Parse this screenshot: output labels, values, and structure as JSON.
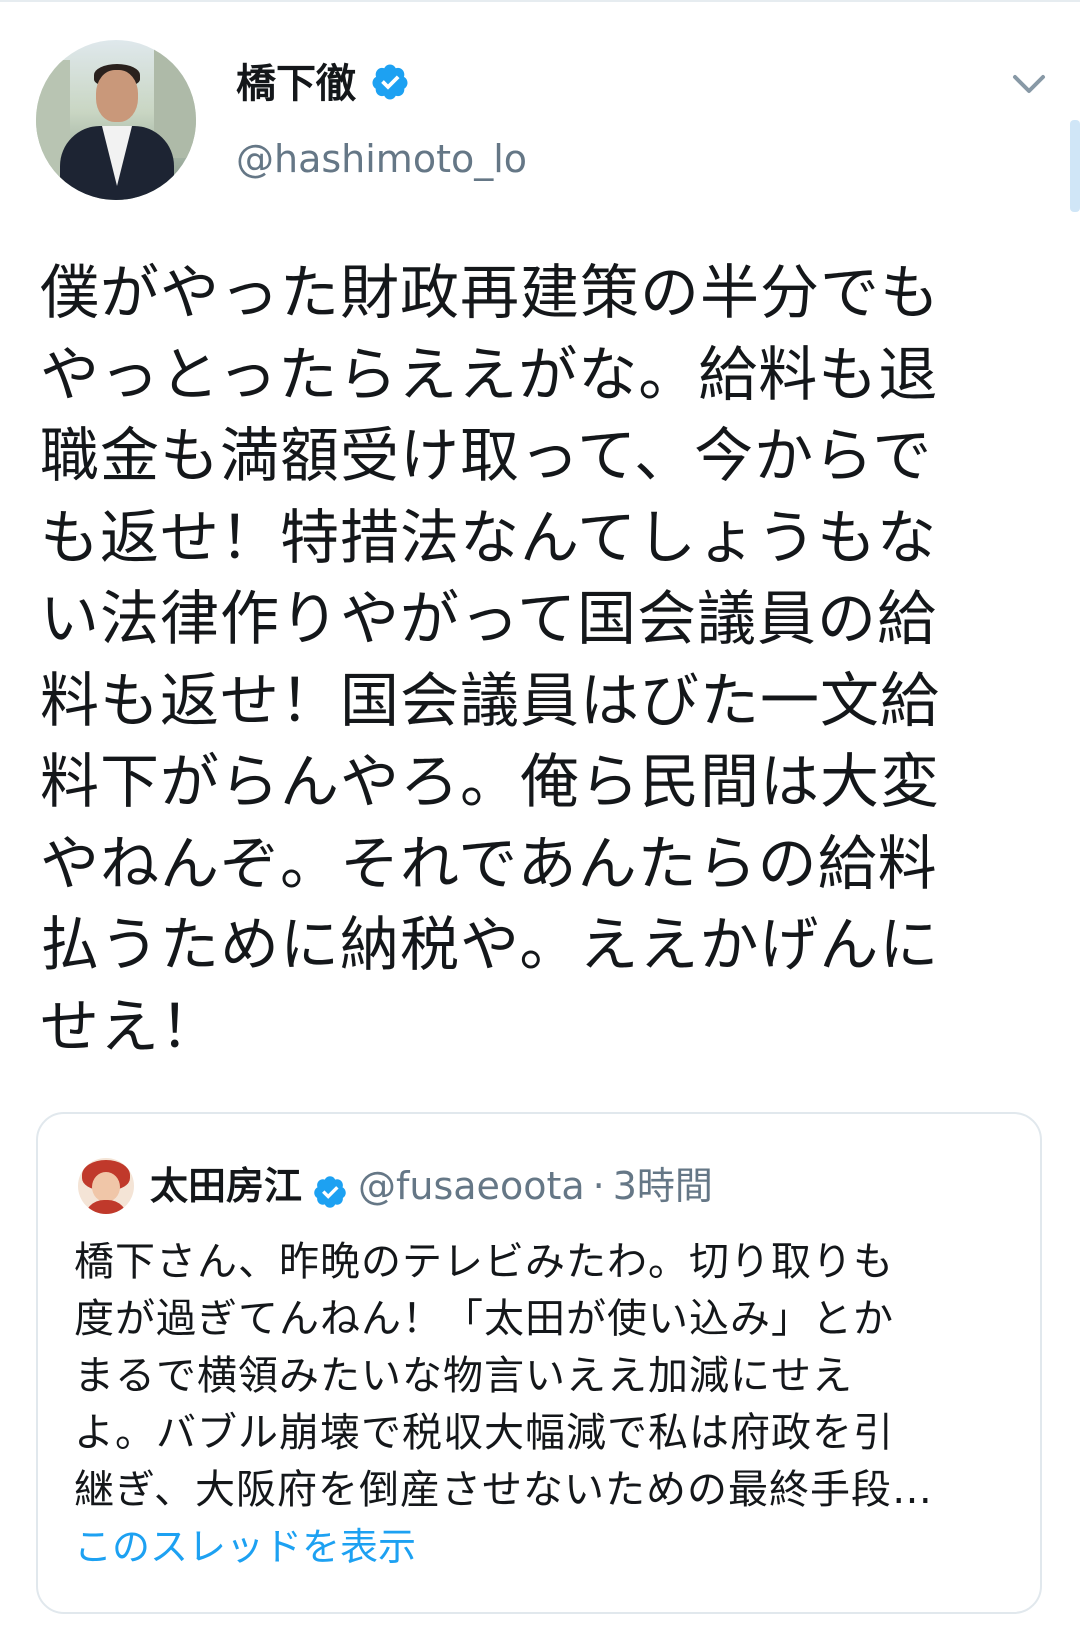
{
  "tweet": {
    "author": {
      "display_name": "橋下徹",
      "handle": "@hashimoto_lo",
      "verified": true
    },
    "text_lines": [
      "僕がやった財政再建策の半分でも",
      "やっとったらええがな。給料も退",
      "職金も満額受け取って、今からで",
      "も返せ！特措法なんてしょうもな",
      "い法律作りやがって国会議員の給",
      "料も返せ！国会議員はびた一文給",
      "料下がらんやろ。俺ら民間は大変",
      "やねんぞ。それであんたらの給料",
      "払うために納税や。ええかげんに",
      "せえ！"
    ]
  },
  "quoted_tweet": {
    "author": {
      "display_name": "太田房江",
      "handle": "@fusaeoota",
      "verified": true
    },
    "separator": "·",
    "time": "3時間",
    "text_lines": [
      "橋下さん、昨晩のテレビみたわ。切り取りも",
      "度が過ぎてんねん！「太田が使い込み」とか",
      "まるで横領みたいな物言いええ加減にせえ",
      "よ。バブル崩壊で税収大幅減で私は府政を引",
      "継ぎ、大阪府を倒産させないための最終手段…"
    ],
    "show_thread_label": "このスレッドを表示"
  },
  "colors": {
    "text": "#14171a",
    "secondary": "#657786",
    "accent": "#1da1f2",
    "border": "#e1e8ed"
  },
  "icons": [
    "verified-badge-icon",
    "chevron-down-icon"
  ]
}
